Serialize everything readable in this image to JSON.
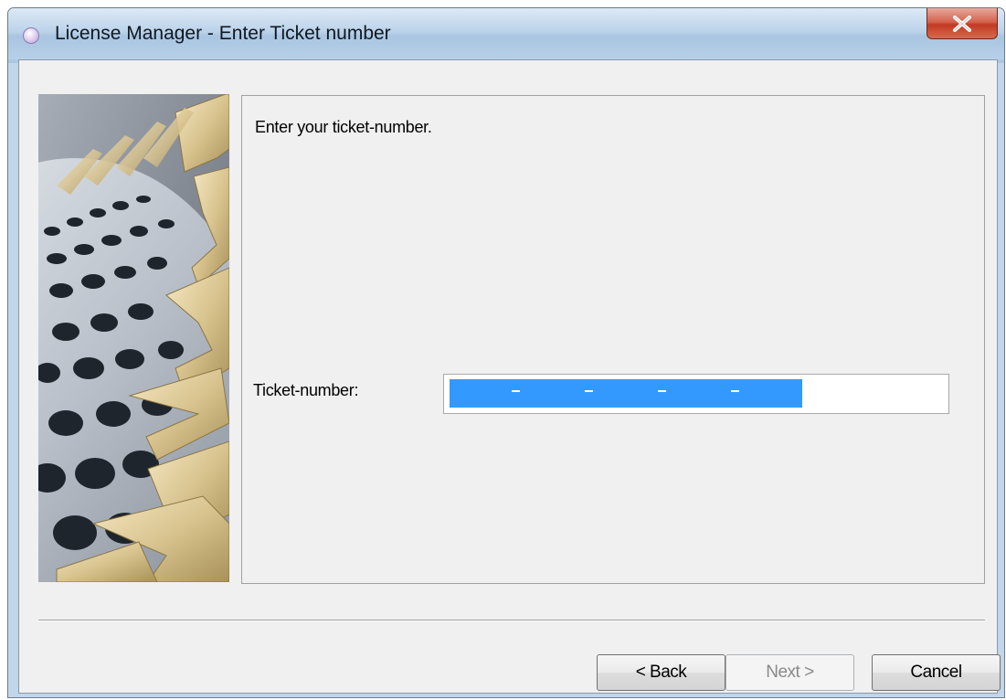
{
  "window": {
    "title": "License Manager - Enter Ticket number",
    "icon": "app-orb-icon",
    "close_icon": "close-icon"
  },
  "content": {
    "instruction": "Enter your ticket-number.",
    "ticket_label": "Ticket-number:",
    "ticket_value_segments": [
      "",
      "",
      "",
      "",
      ""
    ],
    "ticket_separator": "-",
    "ticket_selected": true
  },
  "buttons": {
    "back_label": "< Back",
    "next_label": "Next >",
    "next_enabled": false,
    "cancel_label": "Cancel"
  },
  "colors": {
    "selection": "#3399ff",
    "close_button": "#c23a22",
    "dialog_background": "#f0f0f0"
  }
}
